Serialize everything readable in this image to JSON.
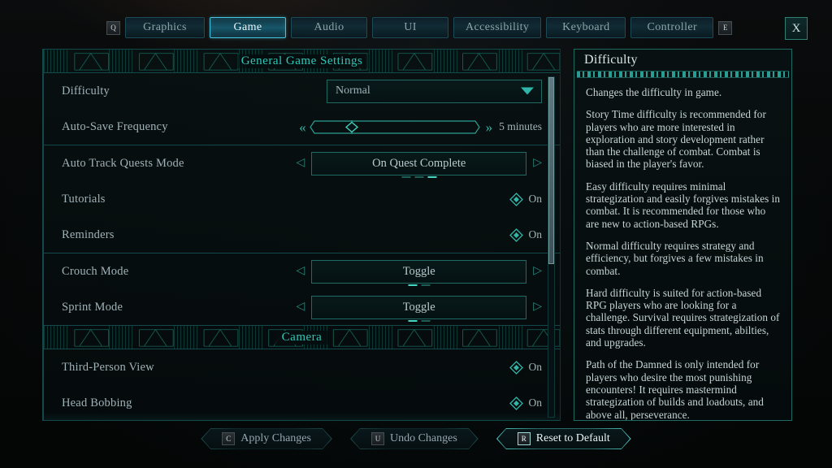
{
  "window": {
    "close_label": "X",
    "close_icon": "close-icon"
  },
  "tabbar": {
    "prev_key_hint": "Q",
    "next_key_hint": "E",
    "tabs": [
      {
        "label": "Graphics",
        "active": false
      },
      {
        "label": "Game",
        "active": true
      },
      {
        "label": "Audio",
        "active": false
      },
      {
        "label": "UI",
        "active": false
      },
      {
        "label": "Accessibility",
        "active": false
      },
      {
        "label": "Keyboard",
        "active": false
      },
      {
        "label": "Controller",
        "active": false
      }
    ]
  },
  "settings": {
    "sections": [
      {
        "title": "General Game Settings",
        "groups": [
          {
            "rows": [
              {
                "label": "Difficulty",
                "type": "dropdown",
                "value": "Normal",
                "icon": "chevron-down-icon"
              },
              {
                "label": "Auto-Save Frequency",
                "type": "slider",
                "value": "5 minutes",
                "fill_percent": 25
              }
            ]
          },
          {
            "rows": [
              {
                "label": "Auto Track Quests Mode",
                "type": "stepper",
                "value": "On Quest Complete",
                "page_count": 3,
                "page_index": 3
              },
              {
                "label": "Tutorials",
                "type": "checkbox",
                "value": "On",
                "checked": true
              },
              {
                "label": "Reminders",
                "type": "checkbox",
                "value": "On",
                "checked": true
              }
            ]
          },
          {
            "rows": [
              {
                "label": "Crouch Mode",
                "type": "stepper",
                "value": "Toggle",
                "page_count": 2,
                "page_index": 1
              },
              {
                "label": "Sprint Mode",
                "type": "stepper",
                "value": "Toggle",
                "page_count": 2,
                "page_index": 1
              }
            ]
          }
        ]
      },
      {
        "title": "Camera",
        "groups": [
          {
            "rows": [
              {
                "label": "Third-Person View",
                "type": "checkbox",
                "value": "On",
                "checked": true
              },
              {
                "label": "Head Bobbing",
                "type": "checkbox",
                "value": "On",
                "checked": true
              }
            ]
          }
        ]
      }
    ],
    "scroll_thumb_percent": 55
  },
  "tooltip": {
    "title": "Difficulty",
    "paragraphs": [
      "Changes the difficulty in game.",
      "Story Time difficulty is recommended for players who are more interested in exploration and story development rather than the challenge of combat. Combat is biased in the player's favor.",
      "Easy difficulty requires minimal strategization and easily forgives mistakes in combat. It is recommended for those who are new to action-based RPGs.",
      "Normal difficulty requires strategy and efficiency, but forgives a few mistakes in combat.",
      "Hard difficulty is suited for action-based RPG players who are looking for a challenge. Survival requires strategization of stats through different equipment, abilties, and upgrades.",
      "Path of the Damned is only intended for players who desire the most punishing encounters! It requires mastermind strategization of builds and loadouts, and above all, perseverance."
    ]
  },
  "bottom_bar": {
    "buttons": [
      {
        "key": "C",
        "label": "Apply Changes",
        "active": false
      },
      {
        "key": "U",
        "label": "Undo Changes",
        "active": false
      },
      {
        "key": "R",
        "label": "Reset to Default",
        "active": true
      }
    ]
  },
  "colors": {
    "accent_teal": "#2ec8b8",
    "accent_cyan": "#45c2dd",
    "text_primary": "#c6d5d6",
    "text_muted": "#9fb2b8",
    "border_teal": "#1d6a63",
    "background": "#050707"
  }
}
